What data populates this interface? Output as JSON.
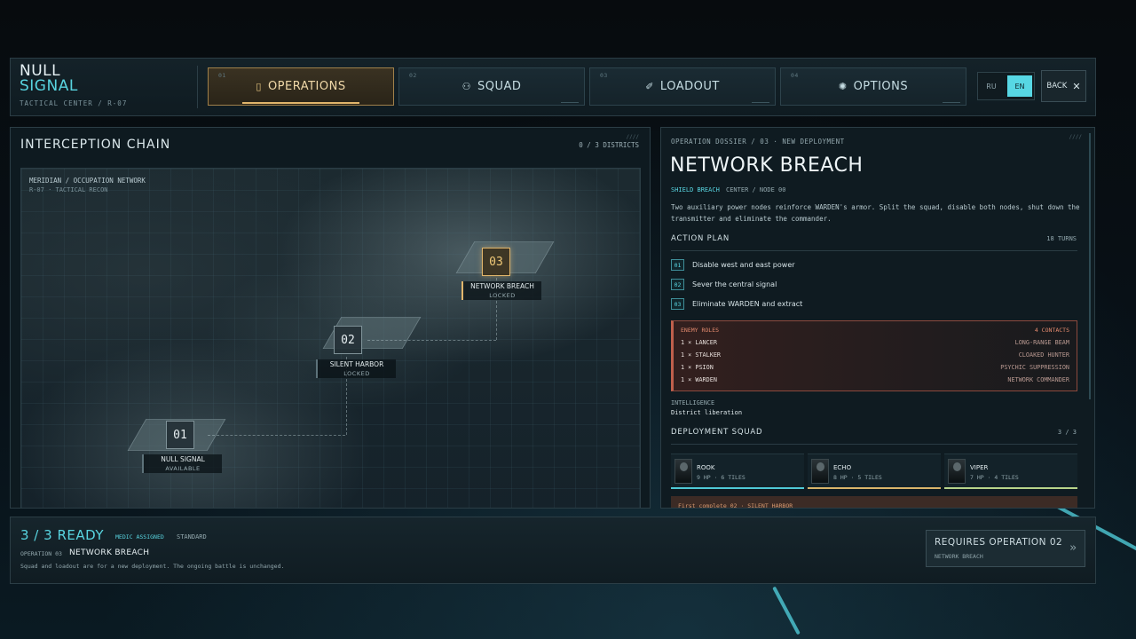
{
  "logo": {
    "line1": "NULL",
    "line2": "SIGNAL",
    "sub": "TACTICAL CENTER / R-07"
  },
  "tabs": [
    {
      "num": "01",
      "icon": "map-icon",
      "glyph": "▯",
      "label": "OPERATIONS",
      "active": true
    },
    {
      "num": "02",
      "icon": "squad-icon",
      "glyph": "⚇",
      "label": "SQUAD",
      "active": false
    },
    {
      "num": "03",
      "icon": "loadout-icon",
      "glyph": "✐",
      "label": "LOADOUT",
      "active": false
    },
    {
      "num": "04",
      "icon": "gear-icon",
      "glyph": "✺",
      "label": "OPTIONS",
      "active": false
    }
  ],
  "lang": {
    "ru": "RU",
    "en": "EN",
    "selected": "EN"
  },
  "back": {
    "label": "BACK",
    "glyph": "✕"
  },
  "map_panel": {
    "title": "INTERCEPTION CHAIN",
    "count": "0 / 3 DISTRICTS",
    "ticks": "////",
    "head1": "MERIDIAN / OCCUPATION NETWORK",
    "head2": "R-07 · TACTICAL RECON",
    "nodes": [
      {
        "num": "01",
        "label": "NULL SIGNAL",
        "status": "AVAILABLE"
      },
      {
        "num": "02",
        "label": "SILENT HARBOR",
        "status": "LOCKED"
      },
      {
        "num": "03",
        "label": "NETWORK BREACH",
        "status": "LOCKED"
      }
    ]
  },
  "dossier": {
    "ticks": "////",
    "crumb": "OPERATION DOSSIER / 03 · NEW DEPLOYMENT",
    "title": "NETWORK BREACH",
    "tag_a": "SHIELD BREACH",
    "tag_b": "CENTER / NODE 00",
    "description": "Two auxiliary power nodes reinforce WARDEN's armor. Split the squad, disable both nodes, shut down the transmitter and eliminate the commander.",
    "action_plan_label": "ACTION PLAN",
    "turns": "18 TURNS",
    "steps": [
      {
        "n": "01",
        "text": "Disable west and east power"
      },
      {
        "n": "02",
        "text": "Sever the central signal"
      },
      {
        "n": "03",
        "text": "Eliminate WARDEN and extract"
      }
    ],
    "enemy": {
      "label": "ENEMY ROLES",
      "contacts": "4 CONTACTS",
      "rows": [
        {
          "unit": "1 × LANCER",
          "role": "LONG-RANGE BEAM"
        },
        {
          "unit": "1 × STALKER",
          "role": "CLOAKED HUNTER"
        },
        {
          "unit": "1 × PSION",
          "role": "PSYCHIC SUPPRESSION"
        },
        {
          "unit": "1 × WARDEN",
          "role": "NETWORK COMMANDER"
        }
      ]
    },
    "intel_label": "INTELLIGENCE",
    "intel_value": "District liberation",
    "squad_label": "DEPLOYMENT SQUAD",
    "squad_count": "3 / 3",
    "squad": [
      {
        "name": "ROOK",
        "stats": "9 HP · 6 TILES",
        "color": "#4fc9d6"
      },
      {
        "name": "ECHO",
        "stats": "8 HP · 5 TILES",
        "color": "#d9b56a"
      },
      {
        "name": "VIPER",
        "stats": "7 HP · 4 TILES",
        "color": "#b8d48a"
      }
    ],
    "warning": "First complete 02 · SILENT HARBOR"
  },
  "bottom": {
    "ready": "3 / 3 READY",
    "medic": "MEDIC ASSIGNED",
    "standard": "STANDARD",
    "op_num": "OPERATION 03",
    "op_name": "NETWORK BREACH",
    "note": "Squad and loadout are for a new deployment. The ongoing battle is unchanged.",
    "button_main": "REQUIRES OPERATION 02",
    "button_sub": "NETWORK BREACH",
    "button_glyph": "»"
  },
  "colors": {
    "accent": "#58d4e0",
    "gold": "#e2b66c",
    "danger": "#c0604c"
  }
}
